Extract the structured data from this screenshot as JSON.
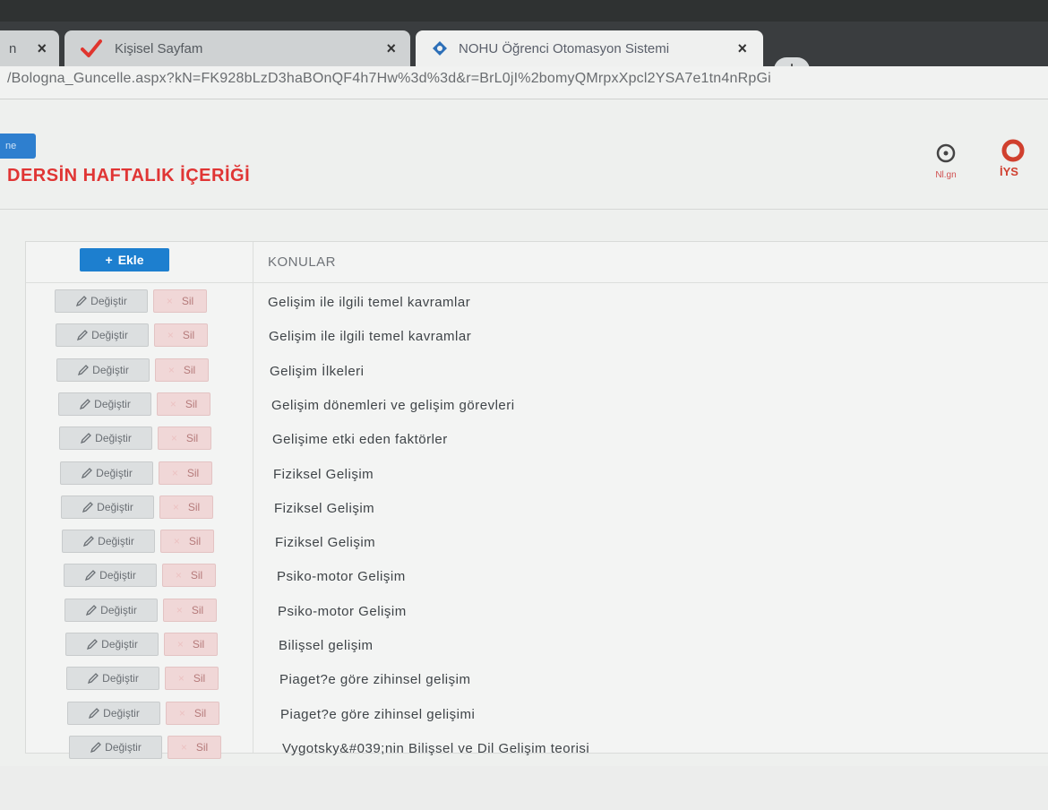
{
  "tabs": [
    {
      "label": "n",
      "active": false
    },
    {
      "label": "Kişisel Sayfam",
      "active": false
    },
    {
      "label": "NOHU Öğrenci Otomasyon Sistemi",
      "active": true
    }
  ],
  "address_bar": {
    "url": "/Bologna_Guncelle.aspx?kN=FK928bLzD3haBOnQF4h7Hw%3d%3d&r=BrL0jI%2bomyQMrpxXpcl2YSA7e1tn4nRpGi"
  },
  "header": {
    "nav_label": "ne",
    "icon_nlgn_label": "Nl.gn",
    "icon_iys_label": "İYS"
  },
  "page_title": "DERSİN HAFTALIK İÇERİĞİ",
  "table": {
    "add_button_label": "Ekle",
    "column_header": "KONULAR",
    "edit_label": "Değiştir",
    "delete_label": "Sil",
    "rows": [
      "Gelişim ile ilgili temel kavramlar",
      "Gelişim ile ilgili temel kavramlar",
      "Gelişim İlkeleri",
      "Gelişim dönemleri ve gelişim görevleri",
      "Gelişime etki eden faktörler",
      "Fiziksel Gelişim",
      "Fiziksel Gelişim",
      "Fiziksel Gelişim",
      "Psiko-motor Gelişim",
      "Psiko-motor Gelişim",
      "Bilişsel gelişim",
      "Piaget?e göre zihinsel gelişim",
      "Piaget?e göre zihinsel gelişimi",
      "Vygotsky&#039;nin Bilişsel ve Dil Gelişim teorisi"
    ]
  },
  "colors": {
    "accent_blue": "#1d7fcf",
    "title_red": "#e03534",
    "delete_bg": "#f0d7d7",
    "edit_bg": "#dcdfe0"
  }
}
